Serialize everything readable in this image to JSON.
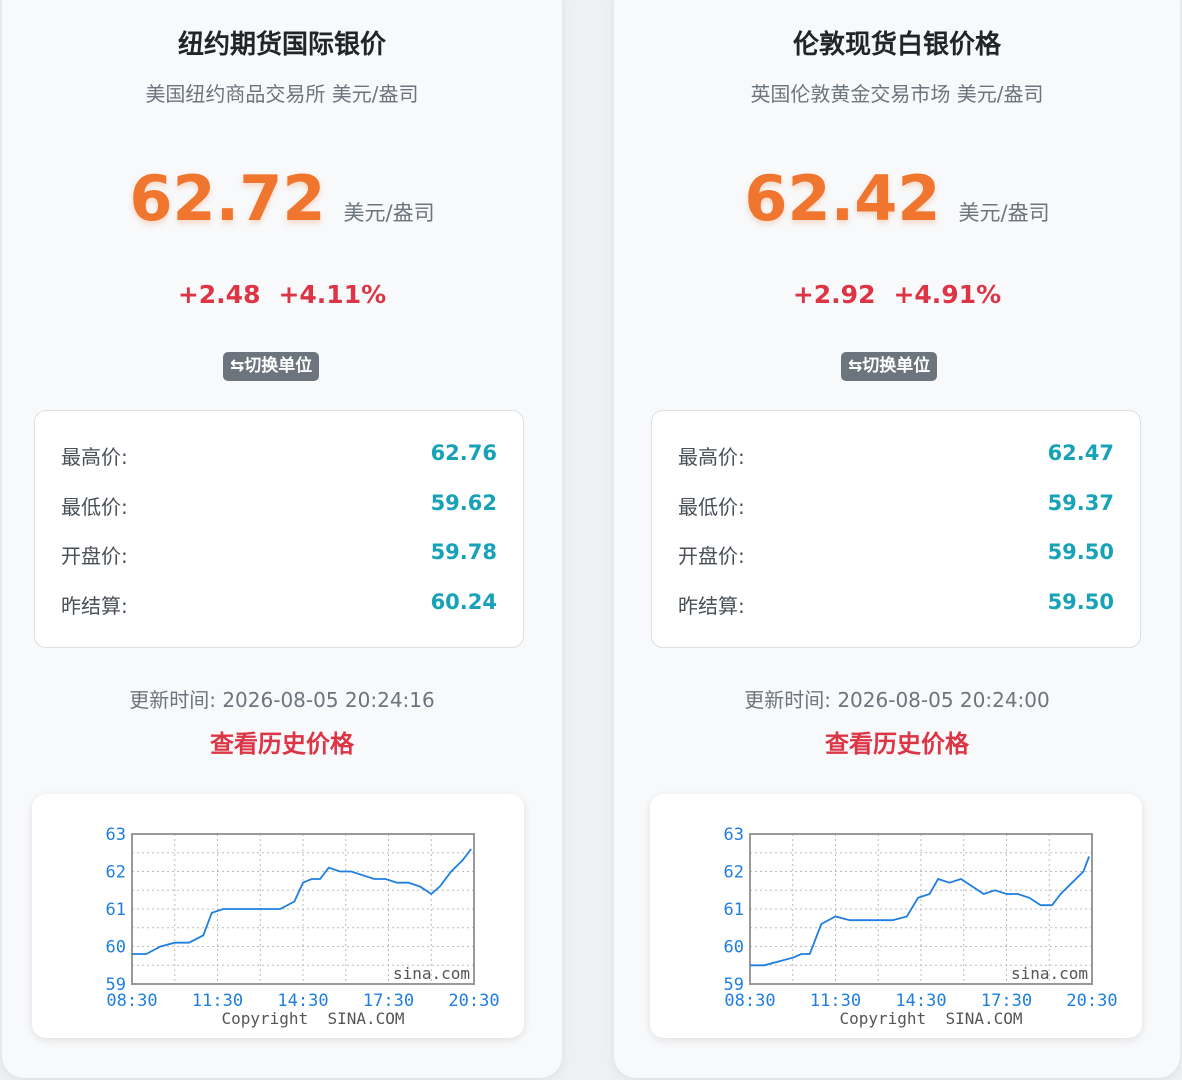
{
  "cards": [
    {
      "title": "纽约期货国际银价",
      "subtitle": "美国纽约商品交易所 美元/盎司",
      "price": "62.72",
      "unit": "美元/盎司",
      "change": "+2.48",
      "change_pct": "+4.11%",
      "switch_label": "⇆切换单位",
      "stats": [
        {
          "label": "最高价:",
          "value": "62.76"
        },
        {
          "label": "最低价:",
          "value": "59.62"
        },
        {
          "label": "开盘价:",
          "value": "59.78"
        },
        {
          "label": "昨结算:",
          "value": "60.24"
        }
      ],
      "updated": "更新时间: 2026-08-05 20:24:16",
      "history_link": "查看历史价格",
      "colors": {
        "price": "#f0752e",
        "change": "#dc3545",
        "stat_value": "#17a2b8",
        "line": "#1f7fe0"
      },
      "chart_data": {
        "type": "line",
        "x_ticks": [
          "08:30",
          "11:30",
          "14:30",
          "17:30",
          "20:30"
        ],
        "y_ticks": [
          "59",
          "60",
          "61",
          "62",
          "63"
        ],
        "ylim": [
          59,
          63
        ],
        "xlim": [
          8.5,
          20.5
        ],
        "watermark": "sina.com",
        "copyright": "Copyright  SINA.COM",
        "grid": true,
        "x": [
          8.5,
          9.0,
          9.5,
          10.0,
          10.5,
          11.0,
          11.3,
          11.7,
          12.2,
          12.8,
          13.3,
          13.7,
          14.2,
          14.5,
          14.8,
          15.1,
          15.4,
          15.8,
          16.2,
          16.6,
          17.0,
          17.4,
          17.8,
          18.2,
          18.6,
          19.0,
          19.3,
          19.7,
          20.1,
          20.4
        ],
        "y": [
          59.8,
          59.8,
          60.0,
          60.1,
          60.1,
          60.3,
          60.9,
          61.0,
          61.0,
          61.0,
          61.0,
          61.0,
          61.2,
          61.7,
          61.8,
          61.8,
          62.1,
          62.0,
          62.0,
          61.9,
          61.8,
          61.8,
          61.7,
          61.7,
          61.6,
          61.4,
          61.6,
          62.0,
          62.3,
          62.6
        ]
      }
    },
    {
      "title": "伦敦现货白银价格",
      "subtitle": "英国伦敦黄金交易市场 美元/盎司",
      "price": "62.42",
      "unit": "美元/盎司",
      "change": "+2.92",
      "change_pct": "+4.91%",
      "switch_label": "⇆切换单位",
      "stats": [
        {
          "label": "最高价:",
          "value": "62.47"
        },
        {
          "label": "最低价:",
          "value": "59.37"
        },
        {
          "label": "开盘价:",
          "value": "59.50"
        },
        {
          "label": "昨结算:",
          "value": "59.50"
        }
      ],
      "updated": "更新时间: 2026-08-05 20:24:00",
      "history_link": "查看历史价格",
      "colors": {
        "price": "#f0752e",
        "change": "#dc3545",
        "stat_value": "#17a2b8",
        "line": "#1f7fe0"
      },
      "chart_data": {
        "type": "line",
        "x_ticks": [
          "08:30",
          "11:30",
          "14:30",
          "17:30",
          "20:30"
        ],
        "y_ticks": [
          "59",
          "60",
          "61",
          "62",
          "63"
        ],
        "ylim": [
          59,
          63
        ],
        "xlim": [
          8.5,
          20.5
        ],
        "watermark": "sina.com",
        "copyright": "Copyright  SINA.COM",
        "grid": true,
        "x": [
          8.5,
          9.0,
          9.5,
          10.0,
          10.3,
          10.6,
          11.0,
          11.5,
          12.0,
          12.5,
          13.0,
          13.5,
          14.0,
          14.4,
          14.8,
          15.1,
          15.5,
          15.9,
          16.3,
          16.7,
          17.1,
          17.5,
          17.9,
          18.3,
          18.7,
          19.1,
          19.4,
          19.8,
          20.2,
          20.4
        ],
        "y": [
          59.5,
          59.5,
          59.6,
          59.7,
          59.8,
          59.8,
          60.6,
          60.8,
          60.7,
          60.7,
          60.7,
          60.7,
          60.8,
          61.3,
          61.4,
          61.8,
          61.7,
          61.8,
          61.6,
          61.4,
          61.5,
          61.4,
          61.4,
          61.3,
          61.1,
          61.1,
          61.4,
          61.7,
          62.0,
          62.4
        ]
      }
    }
  ]
}
